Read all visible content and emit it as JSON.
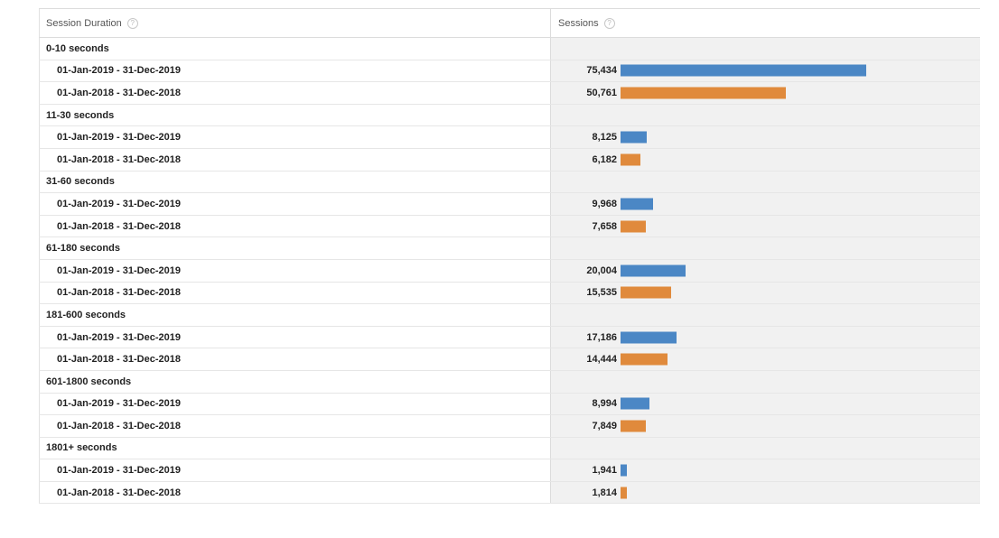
{
  "table": {
    "headers": {
      "dimension": "Session Duration",
      "metric": "Sessions",
      "help_glyph": "?"
    },
    "colors": {
      "current": "#4b87c5",
      "previous": "#e08a3c"
    },
    "bar_max_value": 75434,
    "groups": [
      {
        "label": "0-10 seconds",
        "rows": [
          {
            "period": "01-Jan-2019 - 31-Dec-2019",
            "value": "75,434",
            "num": 75434,
            "series": "current"
          },
          {
            "period": "01-Jan-2018 - 31-Dec-2018",
            "value": "50,761",
            "num": 50761,
            "series": "previous"
          }
        ]
      },
      {
        "label": "11-30 seconds",
        "rows": [
          {
            "period": "01-Jan-2019 - 31-Dec-2019",
            "value": "8,125",
            "num": 8125,
            "series": "current"
          },
          {
            "period": "01-Jan-2018 - 31-Dec-2018",
            "value": "6,182",
            "num": 6182,
            "series": "previous"
          }
        ]
      },
      {
        "label": "31-60 seconds",
        "rows": [
          {
            "period": "01-Jan-2019 - 31-Dec-2019",
            "value": "9,968",
            "num": 9968,
            "series": "current"
          },
          {
            "period": "01-Jan-2018 - 31-Dec-2018",
            "value": "7,658",
            "num": 7658,
            "series": "previous"
          }
        ]
      },
      {
        "label": "61-180 seconds",
        "rows": [
          {
            "period": "01-Jan-2019 - 31-Dec-2019",
            "value": "20,004",
            "num": 20004,
            "series": "current"
          },
          {
            "period": "01-Jan-2018 - 31-Dec-2018",
            "value": "15,535",
            "num": 15535,
            "series": "previous"
          }
        ]
      },
      {
        "label": "181-600 seconds",
        "rows": [
          {
            "period": "01-Jan-2019 - 31-Dec-2019",
            "value": "17,186",
            "num": 17186,
            "series": "current"
          },
          {
            "period": "01-Jan-2018 - 31-Dec-2018",
            "value": "14,444",
            "num": 14444,
            "series": "previous"
          }
        ]
      },
      {
        "label": "601-1800 seconds",
        "rows": [
          {
            "period": "01-Jan-2019 - 31-Dec-2019",
            "value": "8,994",
            "num": 8994,
            "series": "current"
          },
          {
            "period": "01-Jan-2018 - 31-Dec-2018",
            "value": "7,849",
            "num": 7849,
            "series": "previous"
          }
        ]
      },
      {
        "label": "1801+ seconds",
        "rows": [
          {
            "period": "01-Jan-2019 - 31-Dec-2019",
            "value": "1,941",
            "num": 1941,
            "series": "current"
          },
          {
            "period": "01-Jan-2018 - 31-Dec-2018",
            "value": "1,814",
            "num": 1814,
            "series": "previous"
          }
        ]
      }
    ]
  }
}
